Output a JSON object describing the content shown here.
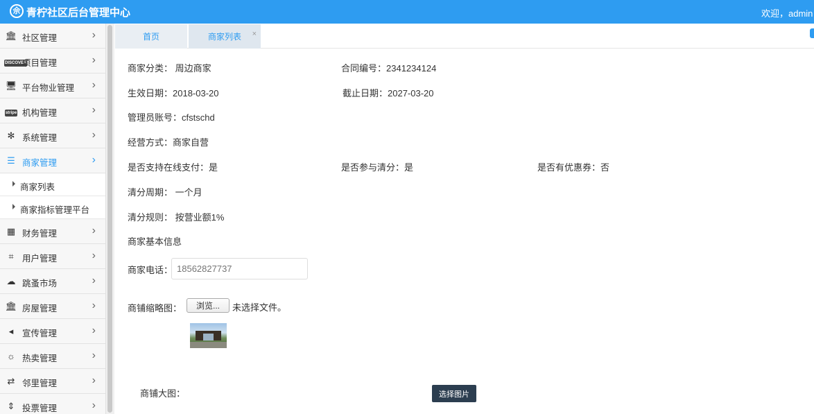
{
  "header": {
    "logo_glyph": "佘",
    "title": "青柠社区后台管理中心",
    "welcome": "欢迎，admin"
  },
  "sidebar": {
    "items": [
      {
        "label": "社区管理",
        "icon": "bank-icon"
      },
      {
        "label": "项目管理",
        "icon": "discover-card-icon"
      },
      {
        "label": "平台物业管理",
        "icon": "monitor-icon"
      },
      {
        "label": "机构管理",
        "icon": "stripe-icon"
      },
      {
        "label": "系统管理",
        "icon": "yelp-icon"
      },
      {
        "label": "商家管理",
        "icon": "list-icon",
        "active": true
      },
      {
        "label": "财务管理",
        "icon": "calculator-icon"
      },
      {
        "label": "用户管理",
        "icon": "crop-icon"
      },
      {
        "label": "跳蚤市场",
        "icon": "cloud-icon"
      },
      {
        "label": "房屋管理",
        "icon": "bank-icon"
      },
      {
        "label": "宣传管理",
        "icon": "volume-icon"
      },
      {
        "label": "热卖管理",
        "icon": "sun-icon"
      },
      {
        "label": "邻里管理",
        "icon": "retweet-icon"
      },
      {
        "label": "投票管理",
        "icon": "sort-icon"
      }
    ],
    "sub_items": [
      "商家列表",
      "商家指标管理平台"
    ],
    "badge_text": {
      "discover": "DISCOVER",
      "stripe": "stripe"
    }
  },
  "tabs": {
    "home": "首页",
    "active": "商家列表",
    "close": "×"
  },
  "detail": {
    "category": "商家分类：  周边商家",
    "contract_no": "合同编号：2341234124",
    "start_date": "生效日期：2018-03-20",
    "end_date": "截止日期：2027-03-20",
    "admin_account": "管理员账号：cfstschd",
    "business_mode": "经营方式：商家自营",
    "online_pay": "是否支持在线支付：是",
    "clearing": "是否参与清分：是",
    "coupon": "是否有优惠券：否",
    "clearing_cycle": "清分周期：  一个月",
    "clearing_rule": "清分规则：  按营业额1%",
    "section_title": "商家基本信息",
    "phone_label": "商家电话：",
    "phone_placeholder": "18562827737",
    "thumb_label": "商铺缩略图：",
    "browse_label": "浏览...",
    "no_file": "未选择文件。",
    "big_image_label": "商铺大图：",
    "select_image_label": "选择图片"
  }
}
